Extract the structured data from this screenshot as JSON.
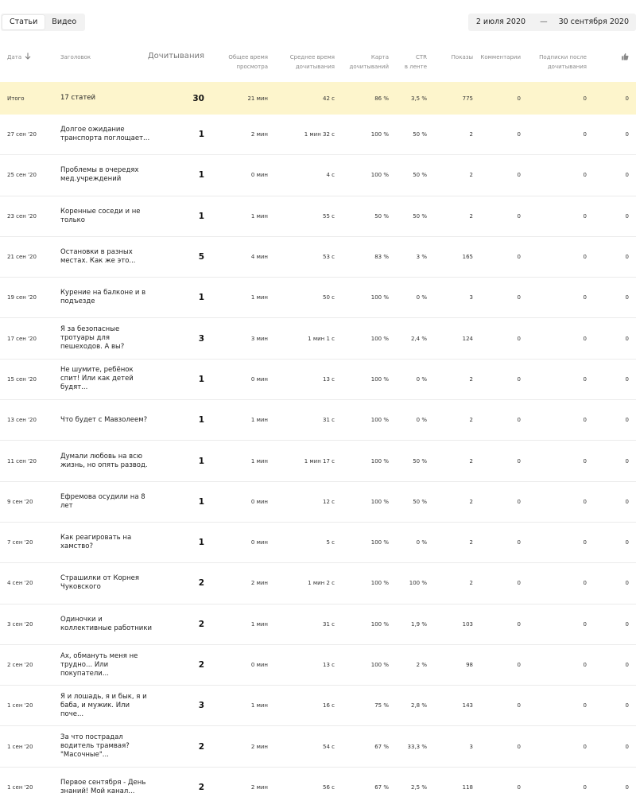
{
  "tabs": [
    {
      "label": "Статьи",
      "active": true
    },
    {
      "label": "Видео",
      "active": false
    }
  ],
  "date_range": {
    "from": "2 июля 2020",
    "separator": "—",
    "to": "30 сентября 2020"
  },
  "columns": {
    "date": "Дата",
    "title": "Заголовок",
    "reads": "Дочитывания",
    "total_time": [
      "Общее время",
      "просмотра"
    ],
    "avg_time": [
      "Среднее время",
      "дочитывания"
    ],
    "map": [
      "Карта",
      "дочитываний"
    ],
    "ctr": [
      "CTR",
      "в ленте"
    ],
    "shows": "Показы",
    "comments": "Комментарии",
    "subs": [
      "Подписки после",
      "дочитывания"
    ],
    "like_icon": "thumbs-up-icon"
  },
  "total": {
    "label": "Итого",
    "title": "17 статей",
    "reads": "30",
    "total_time": "21 мин",
    "avg_time": "42 с",
    "map": "86 %",
    "ctr": "3,5 %",
    "shows": "775",
    "comments": "0",
    "subs": "0",
    "last": "0"
  },
  "rows": [
    {
      "date": "27 сен '20",
      "title": "Долгое ожидание транспорта поглощает...",
      "reads": "1",
      "total_time": "2 мин",
      "avg_time": "1 мин 32 с",
      "map": "100 %",
      "ctr": "50 %",
      "shows": "2",
      "comments": "0",
      "subs": "0",
      "last": "0"
    },
    {
      "date": "25 сен '20",
      "title": "Проблемы в очередях мед.учреждений",
      "reads": "1",
      "total_time": "0 мин",
      "avg_time": "4 с",
      "map": "100 %",
      "ctr": "50 %",
      "shows": "2",
      "comments": "0",
      "subs": "0",
      "last": "0"
    },
    {
      "date": "23 сен '20",
      "title": "Коренные соседи и не только",
      "reads": "1",
      "total_time": "1 мин",
      "avg_time": "55 с",
      "map": "50 %",
      "ctr": "50 %",
      "shows": "2",
      "comments": "0",
      "subs": "0",
      "last": "0"
    },
    {
      "date": "21 сен '20",
      "title": "Остановки в разных местах. Как же это...",
      "reads": "5",
      "total_time": "4 мин",
      "avg_time": "53 с",
      "map": "83 %",
      "ctr": "3 %",
      "shows": "165",
      "comments": "0",
      "subs": "0",
      "last": "0"
    },
    {
      "date": "19 сен '20",
      "title": "Курение на балконе и в подъезде",
      "reads": "1",
      "total_time": "1 мин",
      "avg_time": "50 с",
      "map": "100 %",
      "ctr": "0 %",
      "shows": "3",
      "comments": "0",
      "subs": "0",
      "last": "0"
    },
    {
      "date": "17 сен '20",
      "title": "Я за безопасные тротуары для пешеходов. А вы?",
      "reads": "3",
      "total_time": "3 мин",
      "avg_time": "1 мин 1 с",
      "map": "100 %",
      "ctr": "2,4 %",
      "shows": "124",
      "comments": "0",
      "subs": "0",
      "last": "0"
    },
    {
      "date": "15 сен '20",
      "title": "Не шумите, ребёнок спит! Или как детей будят...",
      "reads": "1",
      "total_time": "0 мин",
      "avg_time": "13 с",
      "map": "100 %",
      "ctr": "0 %",
      "shows": "2",
      "comments": "0",
      "subs": "0",
      "last": "0"
    },
    {
      "date": "13 сен '20",
      "title": "Что будет с Мавзолеем?",
      "reads": "1",
      "total_time": "1 мин",
      "avg_time": "31 с",
      "map": "100 %",
      "ctr": "0 %",
      "shows": "2",
      "comments": "0",
      "subs": "0",
      "last": "0"
    },
    {
      "date": "11 сен '20",
      "title": "Думали любовь на всю жизнь, но опять развод.",
      "reads": "1",
      "total_time": "1 мин",
      "avg_time": "1 мин 17 с",
      "map": "100 %",
      "ctr": "50 %",
      "shows": "2",
      "comments": "0",
      "subs": "0",
      "last": "0"
    },
    {
      "date": "9 сен '20",
      "title": "Ефремова осудили на 8 лет",
      "reads": "1",
      "total_time": "0 мин",
      "avg_time": "12 с",
      "map": "100 %",
      "ctr": "50 %",
      "shows": "2",
      "comments": "0",
      "subs": "0",
      "last": "0"
    },
    {
      "date": "7 сен '20",
      "title": "Как реагировать на хамство?",
      "reads": "1",
      "total_time": "0 мин",
      "avg_time": "5 с",
      "map": "100 %",
      "ctr": "0 %",
      "shows": "2",
      "comments": "0",
      "subs": "0",
      "last": "0"
    },
    {
      "date": "4 сен '20",
      "title": "Страшилки от Корнея Чуковского",
      "reads": "2",
      "total_time": "2 мин",
      "avg_time": "1 мин 2 с",
      "map": "100 %",
      "ctr": "100 %",
      "shows": "2",
      "comments": "0",
      "subs": "0",
      "last": "0"
    },
    {
      "date": "3 сен '20",
      "title": "Одиночки и коллективные работники",
      "reads": "2",
      "total_time": "1 мин",
      "avg_time": "31 с",
      "map": "100 %",
      "ctr": "1,9 %",
      "shows": "103",
      "comments": "0",
      "subs": "0",
      "last": "0"
    },
    {
      "date": "2 сен '20",
      "title": "Ах, обмануть меня не трудно... Или покупатели...",
      "reads": "2",
      "total_time": "0 мин",
      "avg_time": "13 с",
      "map": "100 %",
      "ctr": "2 %",
      "shows": "98",
      "comments": "0",
      "subs": "0",
      "last": "0"
    },
    {
      "date": "1 сен '20",
      "title": "Я и лошадь, я и бык, я и баба, и мужик. Или поче...",
      "reads": "3",
      "total_time": "1 мин",
      "avg_time": "16 с",
      "map": "75 %",
      "ctr": "2,8 %",
      "shows": "143",
      "comments": "0",
      "subs": "0",
      "last": "0"
    },
    {
      "date": "1 сен '20",
      "title": "За что пострадал водитель трамвая? \"Масочные\"...",
      "reads": "2",
      "total_time": "2 мин",
      "avg_time": "54 с",
      "map": "67 %",
      "ctr": "33,3 %",
      "shows": "3",
      "comments": "0",
      "subs": "0",
      "last": "0"
    },
    {
      "date": "1 сен '20",
      "title": "Первое сентября - День знаний! Мой канал...",
      "reads": "2",
      "total_time": "2 мин",
      "avg_time": "56 с",
      "map": "67 %",
      "ctr": "2,5 %",
      "shows": "118",
      "comments": "0",
      "subs": "0",
      "last": "0"
    }
  ]
}
